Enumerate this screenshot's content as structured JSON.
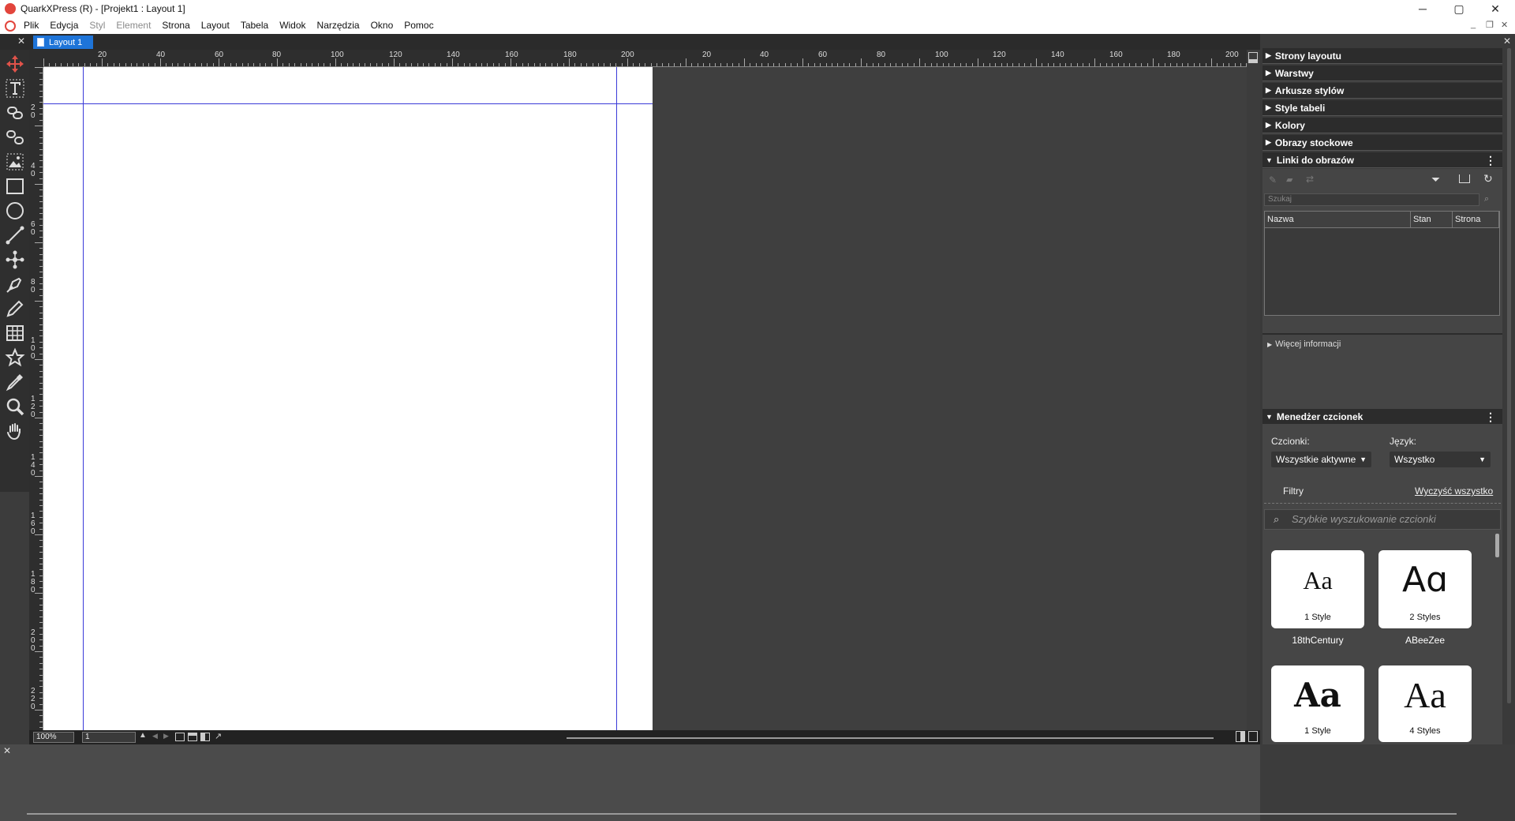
{
  "window": {
    "title": "QuarkXPress (R) - [Projekt1 : Layout 1]",
    "controls": {
      "minimize": "─",
      "maximize": "▢",
      "close": "✕"
    }
  },
  "menubar": {
    "items": [
      {
        "label": "Plik",
        "enabled": true
      },
      {
        "label": "Edycja",
        "enabled": true
      },
      {
        "label": "Styl",
        "enabled": false
      },
      {
        "label": "Element",
        "enabled": false
      },
      {
        "label": "Strona",
        "enabled": true
      },
      {
        "label": "Layout",
        "enabled": true
      },
      {
        "label": "Tabela",
        "enabled": true
      },
      {
        "label": "Widok",
        "enabled": true
      },
      {
        "label": "Narzędzia",
        "enabled": true
      },
      {
        "label": "Okno",
        "enabled": true
      },
      {
        "label": "Pomoc",
        "enabled": true
      }
    ],
    "mdi_controls": {
      "minimize": "_",
      "restore": "❐",
      "close": "✕"
    }
  },
  "document": {
    "tab_label": "Layout 1"
  },
  "toolbox": {
    "tools": [
      "move-item-tool-icon",
      "text-content-tool-icon",
      "text-linking-tool-icon",
      "text-unlinking-tool-icon",
      "picture-content-tool-icon",
      "rectangle-box-tool-icon",
      "oval-box-tool-icon",
      "line-tool-icon",
      "bezier-tool-icon",
      "pen-tool-icon",
      "freehand-tool-icon",
      "table-tool-icon",
      "star-box-tool-icon",
      "eyedropper-tool-icon",
      "zoom-tool-icon",
      "pan-tool-icon"
    ]
  },
  "rulers": {
    "top_labels": [
      "20",
      "40",
      "60",
      "80",
      "100",
      "120",
      "140",
      "160",
      "180",
      "200",
      "20",
      "40",
      "60",
      "80",
      "100",
      "120",
      "140",
      "160",
      "180",
      "200"
    ],
    "left_labels": [
      "2\n0",
      "4\n0",
      "6\n0",
      "8\n0",
      "1\n0\n0",
      "1\n2\n0",
      "1\n4\n0",
      "1\n6\n0",
      "1\n8\n0",
      "2\n0\n0",
      "2\n2\n0"
    ]
  },
  "statusbar": {
    "zoom": "100%",
    "page": "1"
  },
  "panels": {
    "collapsed": [
      "Strony layoutu",
      "Warstwy",
      "Arkusze stylów",
      "Style tabeli",
      "Kolory",
      "Obrazy stockowe"
    ],
    "links": {
      "title": "Linki do obrazów",
      "search_placeholder": "Szukaj",
      "columns": [
        "Nazwa",
        "Stan",
        "Strona"
      ],
      "more_info": "Więcej informacji"
    },
    "font_manager": {
      "title": "Menedżer czcionek",
      "fonts_label": "Czcionki:",
      "fonts_value": "Wszystkie aktywne",
      "language_label": "Język:",
      "language_value": "Wszystko",
      "filters_label": "Filtry",
      "clear_all": "Wyczyść wszystko",
      "search_placeholder": "Szybkie wyszukowanie czcionki",
      "fonts": [
        {
          "sample": "Aa",
          "styles": "1 Style",
          "name": "18thCentury"
        },
        {
          "sample": "Aɑ",
          "styles": "2 Styles",
          "name": "ABeeZee"
        },
        {
          "sample": "Aa",
          "styles": "1 Style",
          "name": ""
        },
        {
          "sample": "Aa",
          "styles": "4 Styles",
          "name": ""
        }
      ]
    }
  },
  "colors": {
    "accent": "#1e74d8",
    "guide": "#3a3ad8",
    "pasteboard": "#3f3f3f"
  }
}
